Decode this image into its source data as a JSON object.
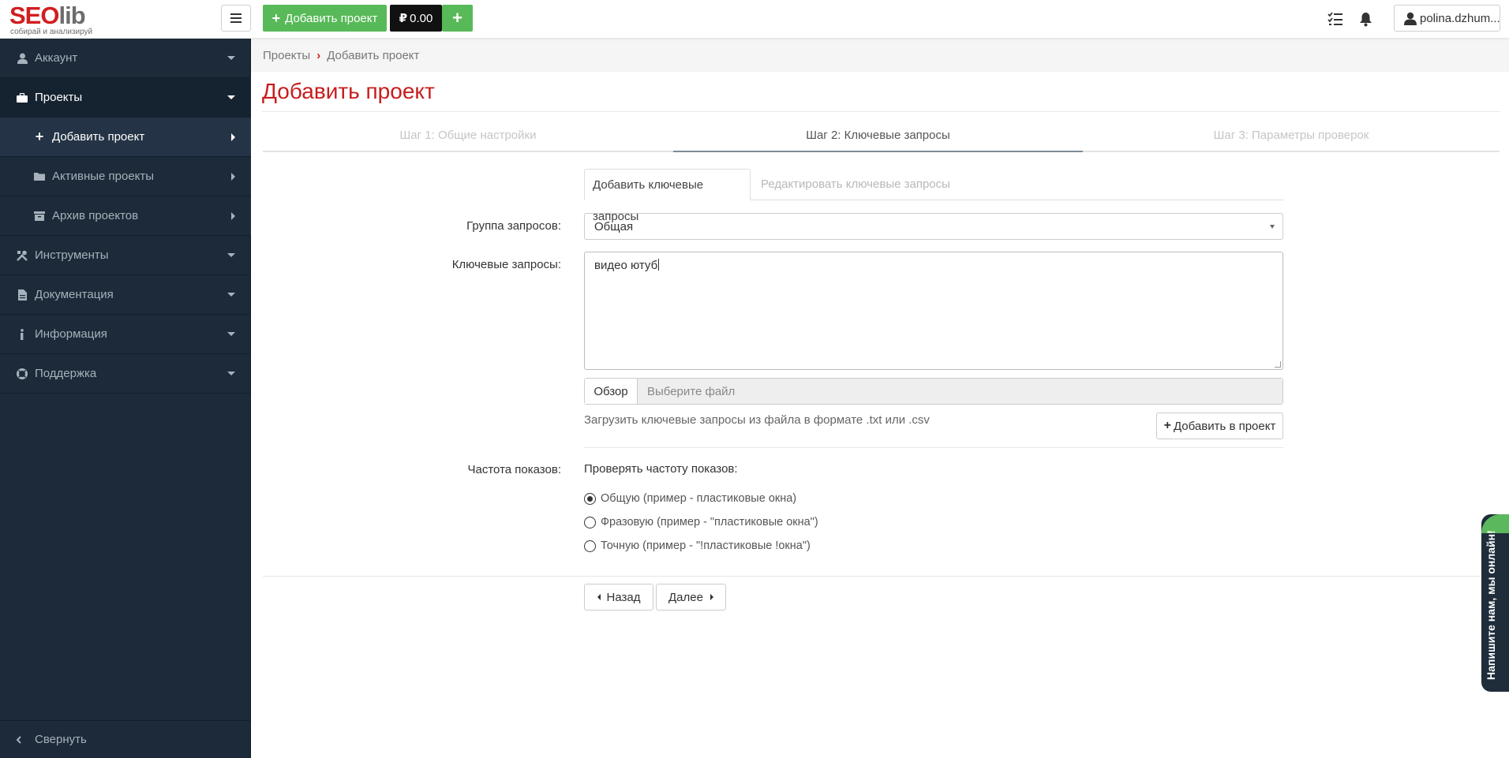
{
  "logo": {
    "main_a": "SEO",
    "main_b": "lib",
    "tagline": "собирай и анализируй"
  },
  "topbar": {
    "add_project_label": "Добавить проект",
    "balance": "0.00",
    "user_name": "polina.dzhum..."
  },
  "sidebar": {
    "items": [
      {
        "label": "Аккаунт"
      },
      {
        "label": "Проекты"
      },
      {
        "label": "Добавить проект"
      },
      {
        "label": "Активные проекты"
      },
      {
        "label": "Архив проектов"
      },
      {
        "label": "Инструменты"
      },
      {
        "label": "Документация"
      },
      {
        "label": "Информация"
      },
      {
        "label": "Поддержка"
      }
    ],
    "collapse_label": "Свернуть"
  },
  "breadcrumb": {
    "parent": "Проекты",
    "current": "Добавить проект"
  },
  "page": {
    "title": "Добавить проект"
  },
  "steps": [
    {
      "label": "Шаг 1: Общие настройки"
    },
    {
      "label": "Шаг 2: Ключевые запросы"
    },
    {
      "label": "Шаг 3: Параметры проверок"
    }
  ],
  "tabs": [
    {
      "label": "Добавить ключевые запросы"
    },
    {
      "label": "Редактировать ключевые запросы"
    }
  ],
  "form": {
    "group_label": "Группа запросов:",
    "group_value": "Общая",
    "keywords_label": "Ключевые запросы:",
    "keywords_value": "видео ютуб",
    "browse_label": "Обзор",
    "file_placeholder": "Выберите файл",
    "file_help": "Загрузить ключевые запросы из файла в формате .txt или .csv",
    "add_to_project_label": "Добавить в проект",
    "frequency_label": "Частота показов:",
    "frequency_title": "Проверять частоту показов:",
    "frequency_options": [
      {
        "label": "Общую (пример - пластиковые окна)"
      },
      {
        "label": "Фразовую (пример - \"пластиковые окна\")"
      },
      {
        "label": "Точную (пример - \"!пластиковые !окна\")"
      }
    ],
    "frequency_selected": 0
  },
  "nav_buttons": {
    "back_label": "Назад",
    "next_label": "Далее"
  },
  "chat": {
    "label": "Напишите нам, мы онлайн!"
  },
  "colors": {
    "brand_red": "#d01f1f",
    "green": "#58b958",
    "sidebar_bg": "#1c2a39"
  }
}
